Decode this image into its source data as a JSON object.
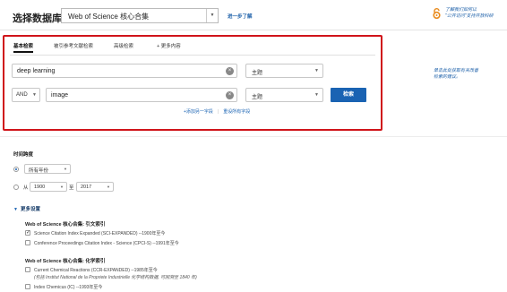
{
  "header": {
    "brand": "选择数据库",
    "database": "Web of Science 核心合集",
    "learn_more": "进一步了解",
    "promo_line1": "了解我们如何以",
    "promo_line2": "\"公开访问\"支持开放科研",
    "colors": {
      "accent": "#1a63b3",
      "promo": "#e98a1c",
      "highlight": "#d0141a"
    }
  },
  "search": {
    "tabs": [
      {
        "label": "基本检索"
      },
      {
        "label": "被引参考文献检索"
      },
      {
        "label": "高级检索"
      },
      {
        "label": "+ 更多内容"
      }
    ],
    "rows": [
      {
        "term": "deep learning",
        "field": "主题"
      },
      {
        "bool": "AND",
        "term": "image",
        "field": "主题"
      }
    ],
    "search_button": "检索",
    "add_row_link": "+添加另一字段",
    "reset_link": "重设所有字段",
    "side_tip_line1": "单击此处获取有关改善",
    "side_tip_line2": "检索的建议。"
  },
  "timespan": {
    "title": "时间跨度",
    "preset": "所有年份",
    "from_label": "从",
    "from_year": "1900",
    "to_label": "至",
    "to_year": "2017"
  },
  "settings": {
    "toggle_label": "更多设置",
    "groups": [
      {
        "title": "Web of Science 核心合集: 引文索引",
        "items": [
          {
            "label": "Science Citation Index Expanded (SCI-EXPANDED) --1900年至今",
            "checked": true
          },
          {
            "label": "Conference Proceedings Citation Index - Science (CPCI-S) --1991年至今",
            "checked": false
          }
        ]
      },
      {
        "title": "Web of Science 核心合集: 化学索引",
        "items": [
          {
            "label": "Current Chemical Reactions (CCR-EXPANDED) --1985年至今",
            "checked": false,
            "note": "(包括 Institut National de la Propriete Industrielle 化学结构数据, 可回溯至 1840 年)"
          },
          {
            "label": "Index Chemicus (IC) --1993年至今",
            "checked": false
          }
        ]
      }
    ]
  }
}
